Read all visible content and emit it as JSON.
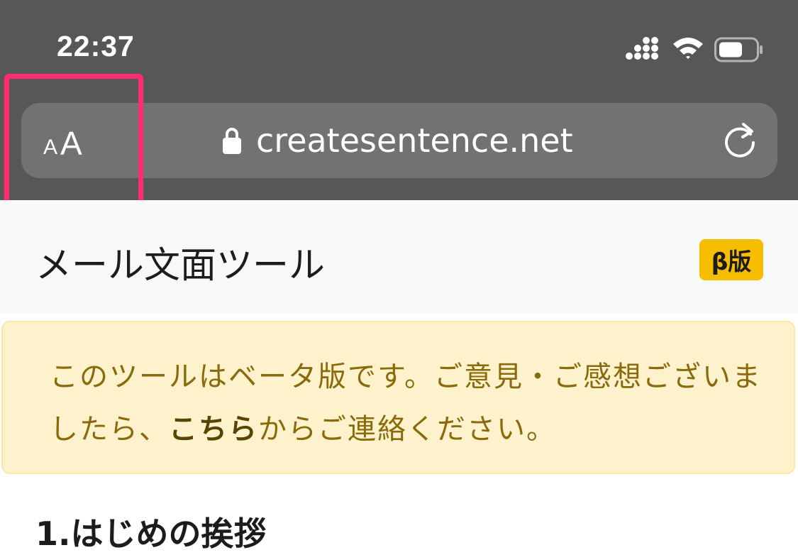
{
  "status_bar": {
    "time": "22:37",
    "icons": [
      "cellular-signal-icon",
      "wifi-icon",
      "battery-icon"
    ]
  },
  "browser": {
    "text_size_small": "A",
    "text_size_large": "A",
    "url": "createsentence.net",
    "lock_icon": "lock-icon",
    "reload_icon": "reload-icon",
    "highlight_color": "#ff2d6e"
  },
  "page": {
    "title": "メール文面ツール",
    "badge": "β版",
    "notice": {
      "line_before_link": "このツールはベータ版です。ご意見・ご感想ございましたら、",
      "link_text": "こちら",
      "line_after_link": "からご連絡ください。"
    },
    "section_heading": "1.はじめの挨拶"
  },
  "colors": {
    "chrome_background": "#575757",
    "address_bar": "#727272",
    "badge": "#f7bd00",
    "notice_background": "#fef2cd",
    "notice_text": "#8a6a0a"
  }
}
